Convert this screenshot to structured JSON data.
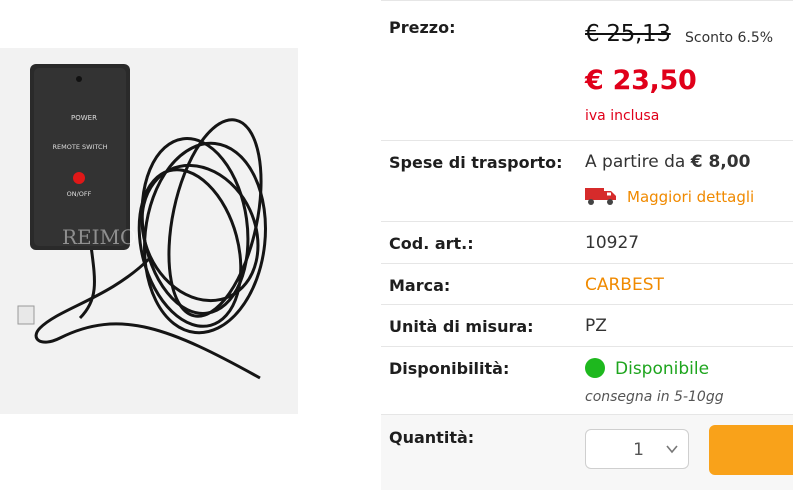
{
  "image": {
    "watermark": "REIMO",
    "device_labels": {
      "power": "POWER",
      "remote_switch": "REMOTE SWITCH",
      "on_off": "ON/OFF"
    }
  },
  "price_row": {
    "label": "Prezzo:",
    "old_price": "€ 25,13",
    "discount": "Sconto 6.5%",
    "price": "€ 23,50",
    "vat_note": "iva inclusa"
  },
  "shipping_row": {
    "label": "Spese di trasporto:",
    "from_text": "A partire da ",
    "from_amount": "€ 8,00",
    "details_link": "Maggiori dettagli",
    "icon": "truck-icon"
  },
  "code_row": {
    "label": "Cod. art.:",
    "value": "10927"
  },
  "brand_row": {
    "label": "Marca:",
    "value": "CARBEST"
  },
  "unit_row": {
    "label": "Unità di misura:",
    "value": "PZ"
  },
  "availability_row": {
    "label": "Disponibilità:",
    "status": "Disponibile",
    "delivery": "consegna in 5-10gg",
    "status_color": "#1eb81e"
  },
  "quantity_row": {
    "label": "Quantità:",
    "value": "1"
  },
  "colors": {
    "price_red": "#e0001a",
    "link_orange": "#f08a00",
    "button_orange": "#f9a21a"
  }
}
